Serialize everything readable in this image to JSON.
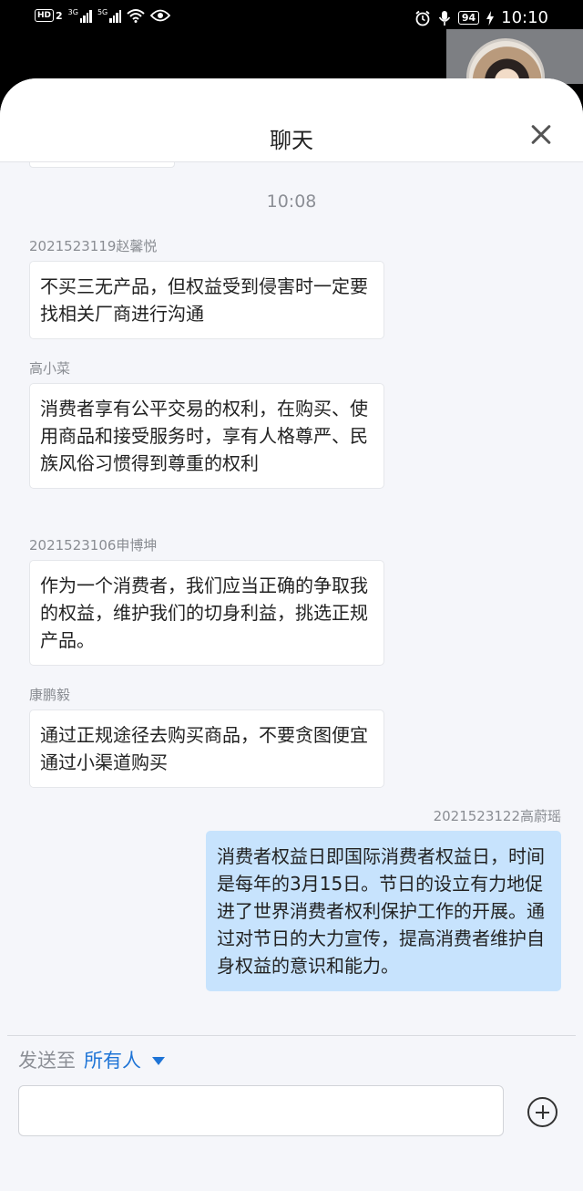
{
  "status_bar": {
    "hd_label": "HD",
    "sim_label": "2",
    "signal1_label": "3G",
    "signal2_label": "5G",
    "battery": "94",
    "time": "10:10",
    "icons": [
      "hd-icon",
      "signal-icon",
      "wifi-icon",
      "eye-icon",
      "alarm-icon",
      "microphone-icon",
      "battery-icon",
      "charging-icon"
    ]
  },
  "panel": {
    "title": "聊天"
  },
  "chat": {
    "time_label": "10:08",
    "messages": [
      {
        "sender": "2021523119赵馨悦",
        "text": "不买三无产品，但权益受到侵害时一定要找相关厂商进行沟通",
        "align": "left"
      },
      {
        "sender": "高小菜",
        "text": "消费者享有公平交易的权利，在购买、使用商品和接受服务时，享有人格尊严、民族风俗习惯得到尊重的权利",
        "align": "left"
      },
      {
        "sender": "2021523106申博坤",
        "text": "作为一个消费者，我们应当正确的争取我的权益，维护我们的切身利益，挑选正规产品。",
        "align": "left"
      },
      {
        "sender": "康鹏毅",
        "text": "通过正规途径去购买商品，不要贪图便宜通过小渠道购买",
        "align": "left"
      },
      {
        "sender": "2021523122高蔚瑶",
        "text": "消费者权益日即国际消费者权益日，时间是每年的3月15日。节日的设立有力地促进了世界消费者权利保护工作的开展。通过对节日的大力宣传，提高消费者维护自身权益的意识和能力。",
        "align": "right"
      }
    ]
  },
  "composer": {
    "send_to_label": "发送至",
    "recipient": "所有人",
    "input_value": "",
    "input_placeholder": ""
  },
  "colors": {
    "accent": "#1e74d6",
    "own_bubble": "#c7e3fd",
    "background": "#f5f6fa"
  }
}
